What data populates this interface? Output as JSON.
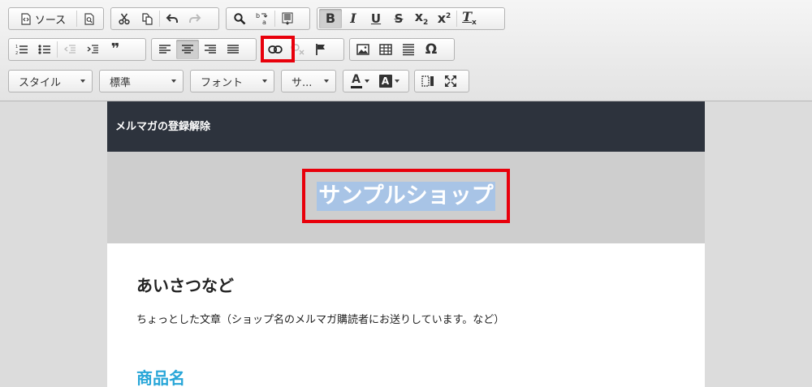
{
  "toolbar": {
    "source_label": "ソース",
    "combos": {
      "style": "スタイル",
      "format": "標準",
      "font": "フォント",
      "size": "サ..."
    },
    "icons": {
      "bold": "B",
      "italic": "I",
      "underline": "U",
      "strike": "S",
      "subscript_base": "x",
      "subscript_mark": "2",
      "superscript_base": "x",
      "superscript_mark": "2",
      "remove_format_base": "T",
      "remove_format_mark": "x",
      "blockquote": "❞",
      "special_char": "Ω",
      "text_color_letter": "A",
      "bg_color_letter": "A"
    },
    "highlight_color": "#e8000b"
  },
  "mail": {
    "header_text": "メルマガの登録解除",
    "shop_name": "サンプルショップ",
    "greeting_title": "あいさつなど",
    "greeting_text": "ちょっとした文章（ショップ名のメルマガ購読者にお送りしています。など）",
    "product_title": "商品名",
    "colors": {
      "header_bg": "#2d333d",
      "banner_bg": "#cecece",
      "selection": "#a8c4e6",
      "product_title": "#28a6d8"
    }
  }
}
